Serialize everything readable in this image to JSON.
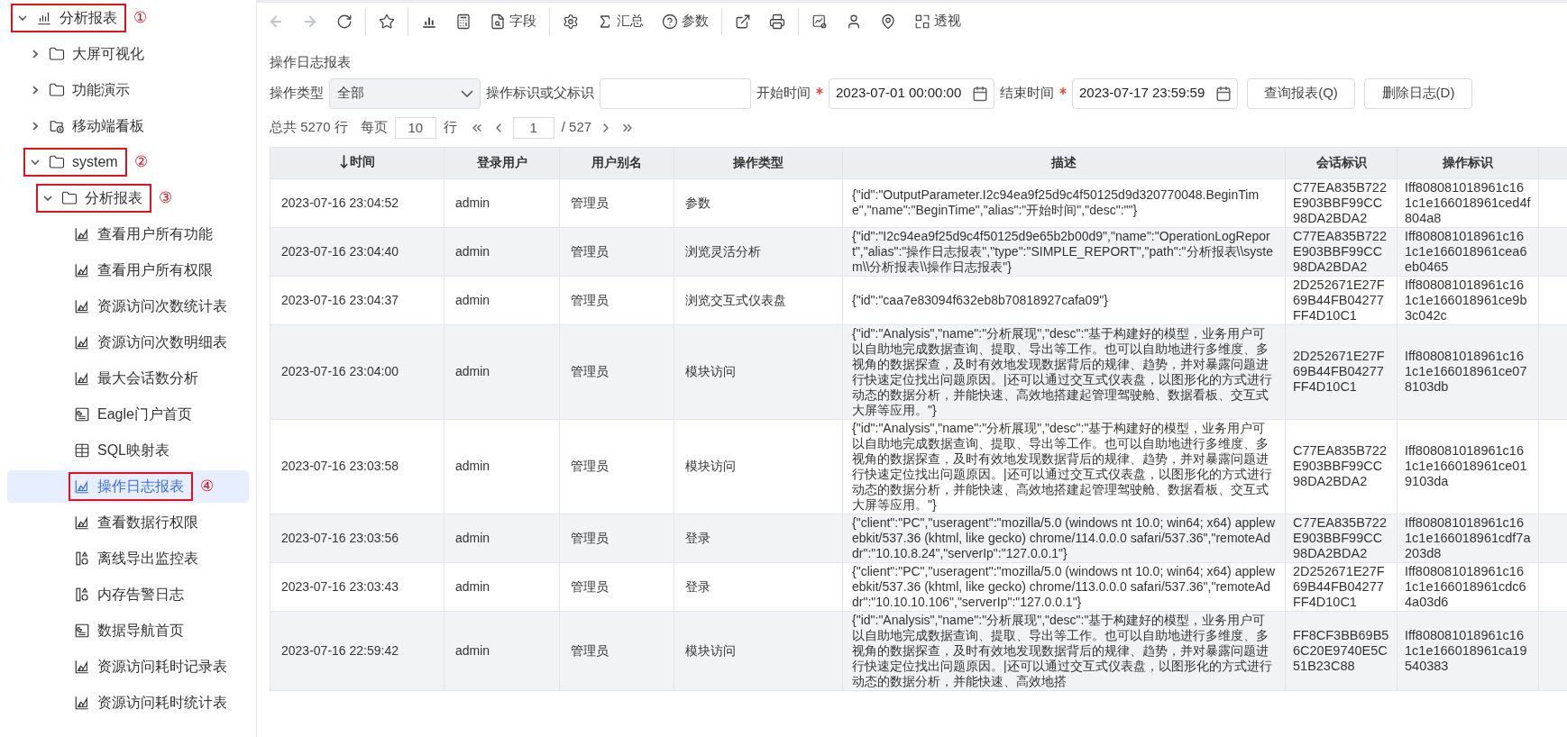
{
  "sidebar": {
    "tree": [
      {
        "label": "分析报表",
        "kind": "report-root",
        "expanded": true,
        "selected": false,
        "annotation": "①",
        "children": [
          {
            "label": "大屏可视化",
            "kind": "folder",
            "expanded": false,
            "selected": false
          },
          {
            "label": "功能演示",
            "kind": "folder",
            "expanded": false,
            "selected": false
          },
          {
            "label": "移动端看板",
            "kind": "mobile-folder",
            "expanded": false,
            "selected": false
          },
          {
            "label": "system",
            "kind": "folder",
            "expanded": true,
            "selected": false,
            "annotation": "②",
            "children": [
              {
                "label": "分析报表",
                "kind": "folder",
                "expanded": true,
                "selected": false,
                "annotation": "③",
                "children": [
                  {
                    "label": "查看用户所有功能",
                    "kind": "report",
                    "selected": false
                  },
                  {
                    "label": "查看用户所有权限",
                    "kind": "report",
                    "selected": false
                  },
                  {
                    "label": "资源访问次数统计表",
                    "kind": "report",
                    "selected": false
                  },
                  {
                    "label": "资源访问次数明细表",
                    "kind": "report",
                    "selected": false
                  },
                  {
                    "label": "最大会话数分析",
                    "kind": "report",
                    "selected": false
                  },
                  {
                    "label": "Eagle门户首页",
                    "kind": "dashboard",
                    "selected": false
                  },
                  {
                    "label": "SQL映射表",
                    "kind": "table",
                    "selected": false
                  },
                  {
                    "label": "操作日志报表",
                    "kind": "report",
                    "selected": true,
                    "annotation": "④"
                  },
                  {
                    "label": "查看数据行权限",
                    "kind": "report",
                    "selected": false
                  },
                  {
                    "label": "离线导出监控表",
                    "kind": "monitor",
                    "selected": false
                  },
                  {
                    "label": "内存告警日志",
                    "kind": "monitor",
                    "selected": false
                  },
                  {
                    "label": "数据导航首页",
                    "kind": "dashboard",
                    "selected": false
                  },
                  {
                    "label": "资源访问耗时记录表",
                    "kind": "report",
                    "selected": false
                  },
                  {
                    "label": "资源访问耗时统计表",
                    "kind": "report",
                    "selected": false
                  }
                ]
              }
            ]
          }
        ]
      }
    ]
  },
  "toolbar": {
    "groups": [
      [
        {
          "kind": "back",
          "disabled": true
        },
        {
          "kind": "forward",
          "disabled": true
        },
        {
          "kind": "refresh",
          "disabled": false
        }
      ],
      [
        {
          "kind": "star",
          "disabled": false
        }
      ],
      [
        {
          "kind": "bar-chart",
          "disabled": false
        },
        {
          "kind": "calculator",
          "disabled": false
        },
        {
          "kind": "fields",
          "label": "字段",
          "disabled": false
        }
      ],
      [
        {
          "kind": "settings",
          "disabled": false
        },
        {
          "kind": "sum",
          "label": "汇总",
          "disabled": false
        },
        {
          "kind": "params",
          "label": "参数",
          "disabled": false
        }
      ],
      [
        {
          "kind": "export",
          "disabled": false
        },
        {
          "kind": "print",
          "disabled": false
        }
      ],
      [
        {
          "kind": "chart-settings",
          "disabled": false
        },
        {
          "kind": "user-help",
          "disabled": false
        },
        {
          "kind": "location",
          "disabled": false
        },
        {
          "kind": "pivot",
          "label": "透视",
          "disabled": false
        }
      ]
    ]
  },
  "report": {
    "title": "操作日志报表",
    "filters": [
      {
        "kind": "select",
        "label": "操作类型",
        "value": "全部"
      },
      {
        "kind": "text",
        "label": "操作标识或父标识"
      },
      {
        "kind": "datetime",
        "label": "开始时间",
        "required": true,
        "value": "2023-07-01 00:00:00"
      },
      {
        "kind": "datetime",
        "label": "结束时间",
        "required": true,
        "value": "2023-07-17 23:59:59"
      }
    ],
    "buttons": [
      "查询报表(Q)",
      "删除日志(D)"
    ],
    "pagination": {
      "total": "总共 5270 行",
      "per_page_label": "每页",
      "per_page": "10",
      "per_page_unit": "行",
      "page": "1",
      "page_count": "/ 527"
    }
  },
  "table": {
    "columns": [
      {
        "label": "时间",
        "sorted": true
      },
      {
        "label": "登录用户",
        "sorted": false
      },
      {
        "label": "用户别名",
        "sorted": false
      },
      {
        "label": "操作类型",
        "sorted": false
      },
      {
        "label": "描述",
        "sorted": false
      },
      {
        "label": "会话标识",
        "sorted": false
      },
      {
        "label": "操作标识",
        "sorted": false
      }
    ],
    "rows": [
      [
        "2023-07-16 23:04:52",
        "admin",
        "管理员",
        "参数",
        "{\"id\":\"OutputParameter.I2c94ea9f25d9c4f50125d9d320770048.BeginTime\",\"name\":\"BeginTime\",\"alias\":\"开始时间\",\"desc\":\"\"}",
        "C77EA835B722E903BBF99CC98DA2BDA2",
        "Iff808081018961c161c1e166018961ced4f804a8"
      ],
      [
        "2023-07-16 23:04:40",
        "admin",
        "管理员",
        "浏览灵活分析",
        "{\"id\":\"I2c94ea9f25d9c4f50125d9e65b2b00d9\",\"name\":\"OperationLogReport\",\"alias\":\"操作日志报表\",\"type\":\"SIMPLE_REPORT\",\"path\":\"分析报表\\\\system\\\\分析报表\\\\操作日志报表\"}",
        "C77EA835B722E903BBF99CC98DA2BDA2",
        "Iff808081018961c161c1e166018961cea6eb0465"
      ],
      [
        "2023-07-16 23:04:37",
        "admin",
        "管理员",
        "浏览交互式仪表盘",
        "{\"id\":\"caa7e83094f632eb8b70818927cafa09\"}",
        "2D252671E27F69B44FB04277FF4D10C1",
        "Iff808081018961c161c1e166018961ce9b3c042c"
      ],
      [
        "2023-07-16 23:04:00",
        "admin",
        "管理员",
        "模块访问",
        "{\"id\":\"Analysis\",\"name\":\"分析展现\",\"desc\":\"基于构建好的模型，业务用户可以自助地完成数据查询、提取、导出等工作。也可以自助地进行多维度、多视角的数据探查，及时有效地发现数据背后的规律、趋势，并对暴露问题进行快速定位找出问题原因。|还可以通过交互式仪表盘，以图形化的方式进行动态的数据分析，并能快速、高效地搭建起管理驾驶舱、数据看板、交互式大屏等应用。\"}",
        "2D252671E27F69B44FB04277FF4D10C1",
        "Iff808081018961c161c1e166018961ce078103db"
      ],
      [
        "2023-07-16 23:03:58",
        "admin",
        "管理员",
        "模块访问",
        "{\"id\":\"Analysis\",\"name\":\"分析展现\",\"desc\":\"基于构建好的模型，业务用户可以自助地完成数据查询、提取、导出等工作。也可以自助地进行多维度、多视角的数据探查，及时有效地发现数据背后的规律、趋势，并对暴露问题进行快速定位找出问题原因。|还可以通过交互式仪表盘，以图形化的方式进行动态的数据分析，并能快速、高效地搭建起管理驾驶舱、数据看板、交互式大屏等应用。\"}",
        "C77EA835B722E903BBF99CC98DA2BDA2",
        "Iff808081018961c161c1e166018961ce019103da"
      ],
      [
        "2023-07-16 23:03:56",
        "admin",
        "管理员",
        "登录",
        "{\"client\":\"PC\",\"useragent\":\"mozilla/5.0 (windows nt 10.0; win64; x64) applewebkit/537.36 (khtml, like gecko) chrome/114.0.0.0 safari/537.36\",\"remoteAddr\":\"10.10.8.24\",\"serverIp\":\"127.0.0.1\"}",
        "C77EA835B722E903BBF99CC98DA2BDA2",
        "Iff808081018961c161c1e166018961cdf7a203d8"
      ],
      [
        "2023-07-16 23:03:43",
        "admin",
        "管理员",
        "登录",
        "{\"client\":\"PC\",\"useragent\":\"mozilla/5.0 (windows nt 10.0; win64; x64) applewebkit/537.36 (khtml, like gecko) chrome/113.0.0.0 safari/537.36\",\"remoteAddr\":\"10.10.10.106\",\"serverIp\":\"127.0.0.1\"}",
        "2D252671E27F69B44FB04277FF4D10C1",
        "Iff808081018961c161c1e166018961cdc64a03d6"
      ],
      [
        "2023-07-16 22:59:42",
        "admin",
        "管理员",
        "模块访问",
        "{\"id\":\"Analysis\",\"name\":\"分析展现\",\"desc\":\"基于构建好的模型，业务用户可以自助地完成数据查询、提取、导出等工作。也可以自助地进行多维度、多视角的数据探查，及时有效地发现数据背后的规律、趋势，并对暴露问题进行快速定位找出问题原因。|还可以通过交互式仪表盘，以图形化的方式进行动态的数据分析，并能快速、高效地搭",
        "FF8CF3BB69B56C20E9740E5C51B23C88",
        "Iff808081018961c161c1e166018961ca19540383"
      ]
    ]
  }
}
